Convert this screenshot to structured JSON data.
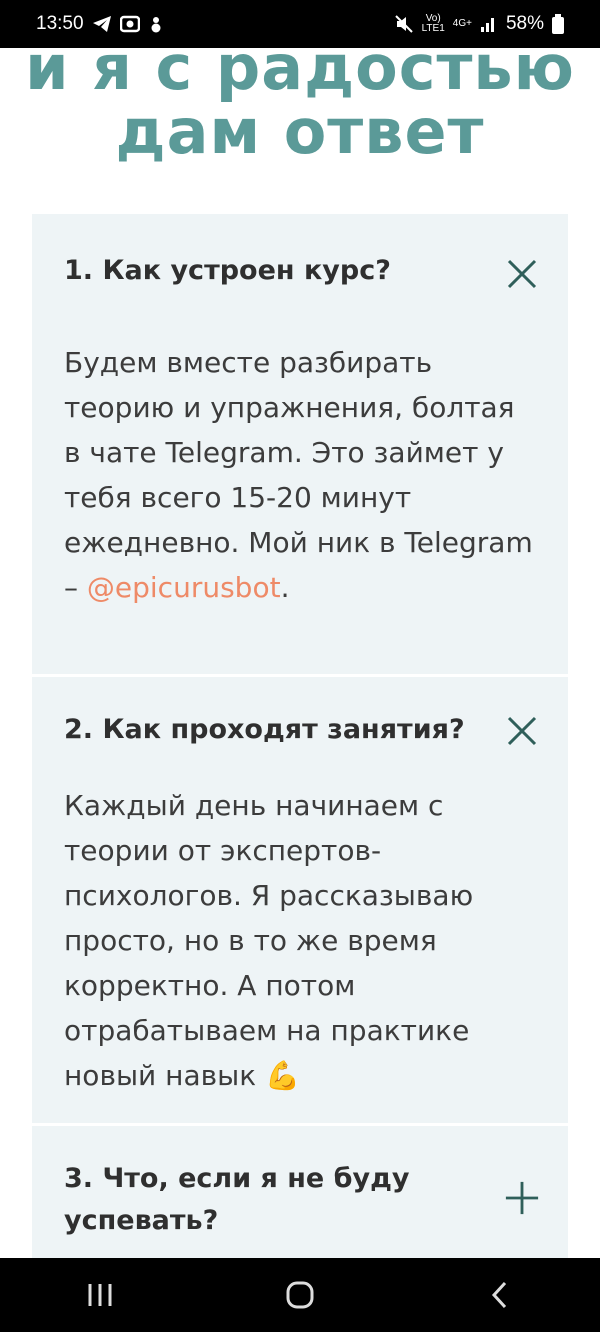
{
  "status": {
    "time": "13:50",
    "network_top": "Vo)",
    "network_bottom": "LTE1",
    "signal_type": "4G+",
    "battery": "58%"
  },
  "hero": {
    "line1": "и я с радостью",
    "line2": "дам ответ"
  },
  "faq": [
    {
      "question": "1. Как устроен курс?",
      "answer_text": "Будем вместе разбирать теорию и упражнения, болтая в чате Telegram. Это займет у тебя всего 15-20 минут ежедневно. Мой ник в Telegram – ",
      "answer_link": "@epicurusbot",
      "answer_tail": ".",
      "state": "expanded"
    },
    {
      "question": "2. Как проходят занятия?",
      "answer_text": "Каждый день начинаем с теории от экспертов-психологов. Я рассказываю просто, но в то же время корректно. А потом отрабатываем на практике новый навык ",
      "emoji": "💪",
      "state": "expanded"
    },
    {
      "question": "3. Что, если я не буду успевать?",
      "state": "collapsed"
    }
  ],
  "colors": {
    "accent_heading": "#5b9a98",
    "card_bg": "#eef4f6",
    "link": "#ee8a67",
    "icon": "#2f5f5a"
  }
}
